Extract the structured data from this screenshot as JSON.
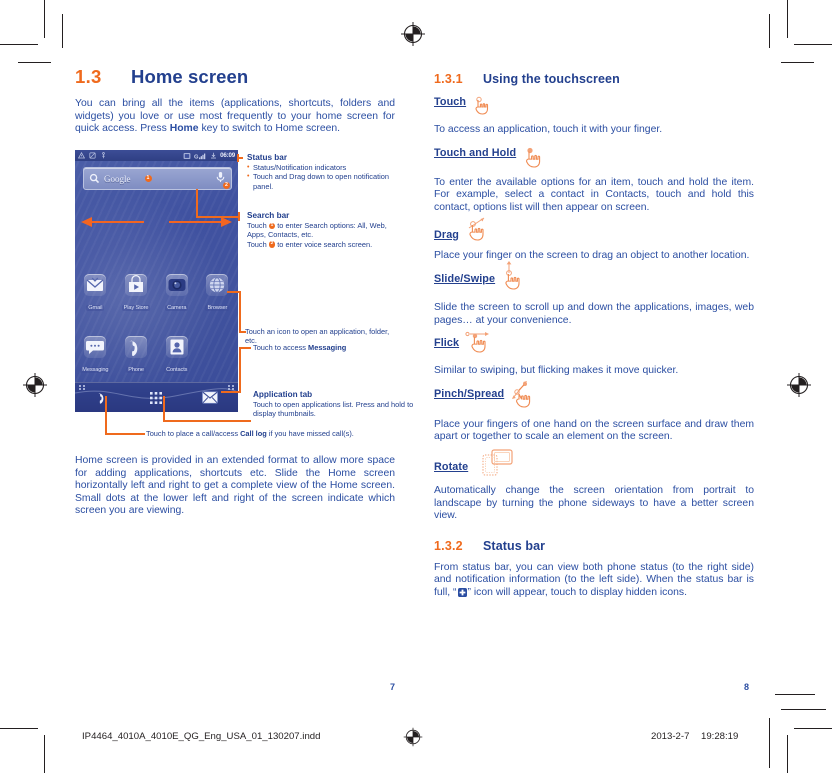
{
  "document": {
    "left_page_number": "7",
    "right_page_number": "8",
    "footer_filename": "IP4464_4010A_4010E_QG_Eng_USA_01_130207.indd",
    "footer_date": "2013-2-7",
    "footer_time": "19:28:19"
  },
  "colors": {
    "heading_blue": "#23408e",
    "body_blue": "#2b4ea2",
    "accent_orange": "#ef6a1d",
    "phone_screen_blue": "#41539f"
  },
  "left": {
    "section": {
      "number": "1.3",
      "title": "Home screen"
    },
    "intro": "You can bring all the items (applications, shortcuts, folders and widgets) you love or use most frequently to your home screen for quick access. Press <b>Home</b> key to switch to Home screen.",
    "outro": "Home screen is provided in an extended format to allow more space for adding applications, shortcuts etc. Slide the Home screen horizontally left and right to get a complete view of the Home screen. Small dots at the lower left and right of the screen indicate which screen you are viewing."
  },
  "phone": {
    "status_bar": {
      "left_icons": [
        "warning-triangle-icon",
        "sim-card-icon",
        "usb-icon"
      ],
      "right_icons": [
        "screenshot-icon",
        "gprs-signal-icon",
        "download-icon"
      ],
      "clock": "06:09"
    },
    "search_bar": {
      "logo_text": "Google",
      "search_icon": "magnifier-icon",
      "voice_icon": "microphone-icon",
      "marker_one": "1",
      "marker_two": "2"
    },
    "apps_row_1": [
      {
        "label": "Gmail",
        "icon": "gmail-icon"
      },
      {
        "label": "Play Store",
        "icon": "play-store-icon"
      },
      {
        "label": "Camera",
        "icon": "camera-icon"
      },
      {
        "label": "Browser",
        "icon": "browser-icon"
      }
    ],
    "apps_row_2": [
      {
        "label": "Messaging",
        "icon": "messaging-icon"
      },
      {
        "label": "Phone",
        "icon": "phone-handset-icon"
      },
      {
        "label": "Contacts",
        "icon": "contacts-icon"
      }
    ],
    "dock": [
      {
        "icon": "phone-handset-icon",
        "name": "dock-phone"
      },
      {
        "icon": "app-grid-icon",
        "name": "dock-application-tab"
      },
      {
        "icon": "envelope-icon",
        "name": "dock-messaging"
      }
    ]
  },
  "annotations": {
    "status_bar": {
      "title": "Status bar",
      "bullets": [
        "Status/Notification indicators",
        "Touch and Drag down to open notification panel."
      ]
    },
    "search_bar": {
      "title": "Search bar",
      "line1_before": "Touch ",
      "line1_marker": "1",
      "line1_after": " to enter Search options: All, Web, Apps, Contacts, etc.",
      "line2_before": "Touch ",
      "line2_marker": "2",
      "line2_after": " to enter voice search screen."
    },
    "icon_note": "Touch an icon to open an application, folder, etc.",
    "messaging_note": "Touch to access <b>Messaging</b>",
    "application_tab": {
      "title": "Application tab",
      "text": "Touch to open applications list. Press and hold to display thumbnails."
    },
    "call_log_note": "Touch to place a call/access <b>Call log</b> if you have missed call(s)."
  },
  "right": {
    "section_1": {
      "number": "1.3.1",
      "title": "Using the touchscreen"
    },
    "gestures": [
      {
        "name": "Touch",
        "icon": "hand-touch-icon",
        "text": "To access an application, touch it with your finger."
      },
      {
        "name": "Touch and Hold",
        "icon": "hand-touch-hold-icon",
        "text": "To enter the available options for an item, touch and hold the item. For example, select a contact in Contacts, touch and hold this contact, options list will then appear on screen."
      },
      {
        "name": "Drag",
        "icon": "hand-drag-icon",
        "text": "Place your finger on the screen to drag an object to another location."
      },
      {
        "name": "Slide/Swipe",
        "icon": "hand-slide-icon",
        "text": "Slide the screen to scroll up and down the applications, images, web pages… at your convenience."
      },
      {
        "name": "Flick",
        "icon": "hand-flick-icon",
        "text": "Similar to swiping, but flicking makes it move quicker."
      },
      {
        "name": "Pinch/Spread",
        "icon": "hand-pinch-icon",
        "text": "Place your fingers of one hand on the screen surface and draw them apart or together to scale an element on the screen."
      },
      {
        "name": "Rotate",
        "icon": "phone-rotate-icon",
        "text": "Automatically change the screen orientation from portrait to landscape by turning the phone sideways to have a better screen view."
      }
    ],
    "section_2": {
      "number": "1.3.2",
      "title": "Status bar"
    },
    "status_bar_text_before": "From status bar, you can view both phone status (to the right side) and notification information (to the left side). When the status bar is full, “",
    "status_bar_icon": "plus-badge-icon",
    "status_bar_text_after": "” icon will appear, touch to display hidden icons."
  }
}
